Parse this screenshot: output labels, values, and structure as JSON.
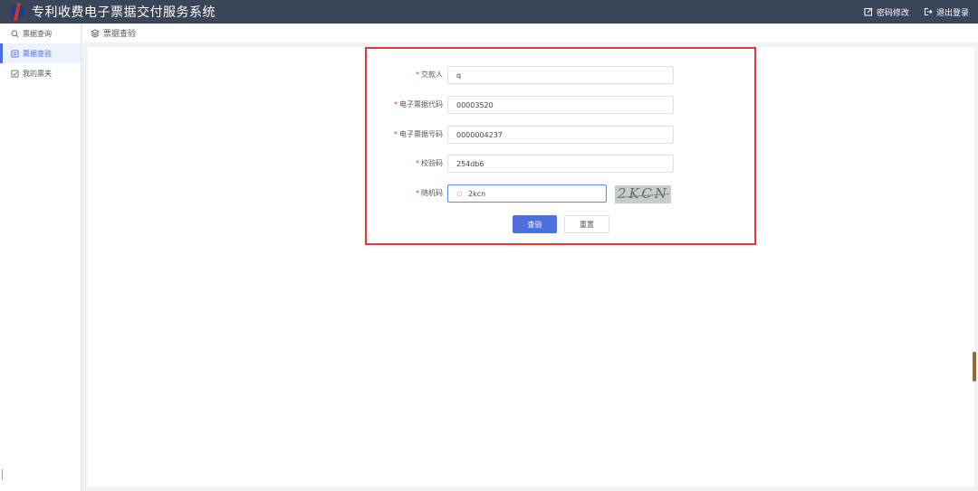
{
  "app": {
    "title": "专利收费电子票据交付服务系统",
    "change_password": "密码修改",
    "logout": "退出登录"
  },
  "sidebar": {
    "items": [
      {
        "label": "票据查询",
        "icon": "search-icon"
      },
      {
        "label": "票据查验",
        "icon": "document-check-icon"
      },
      {
        "label": "我的票夹",
        "icon": "folder-check-icon"
      }
    ]
  },
  "breadcrumb": {
    "label": "票据查验",
    "icon": "layers-icon"
  },
  "form": {
    "payer": {
      "label": "交款人",
      "value": "q"
    },
    "invoice_code": {
      "label": "电子票据代码",
      "value": "00003520"
    },
    "invoice_number": {
      "label": "电子票据号码",
      "value": "0000004237"
    },
    "check_code": {
      "label": "校验码",
      "value": "254db6"
    },
    "random_code": {
      "label": "随机码",
      "value": "2kcn",
      "captcha": "2KCN"
    },
    "required_mark": "*"
  },
  "buttons": {
    "verify": "查验",
    "reset": "重置"
  },
  "colors": {
    "topbar": "#3a4558",
    "accent": "#4f6fdd",
    "highlight": "#e53935"
  }
}
